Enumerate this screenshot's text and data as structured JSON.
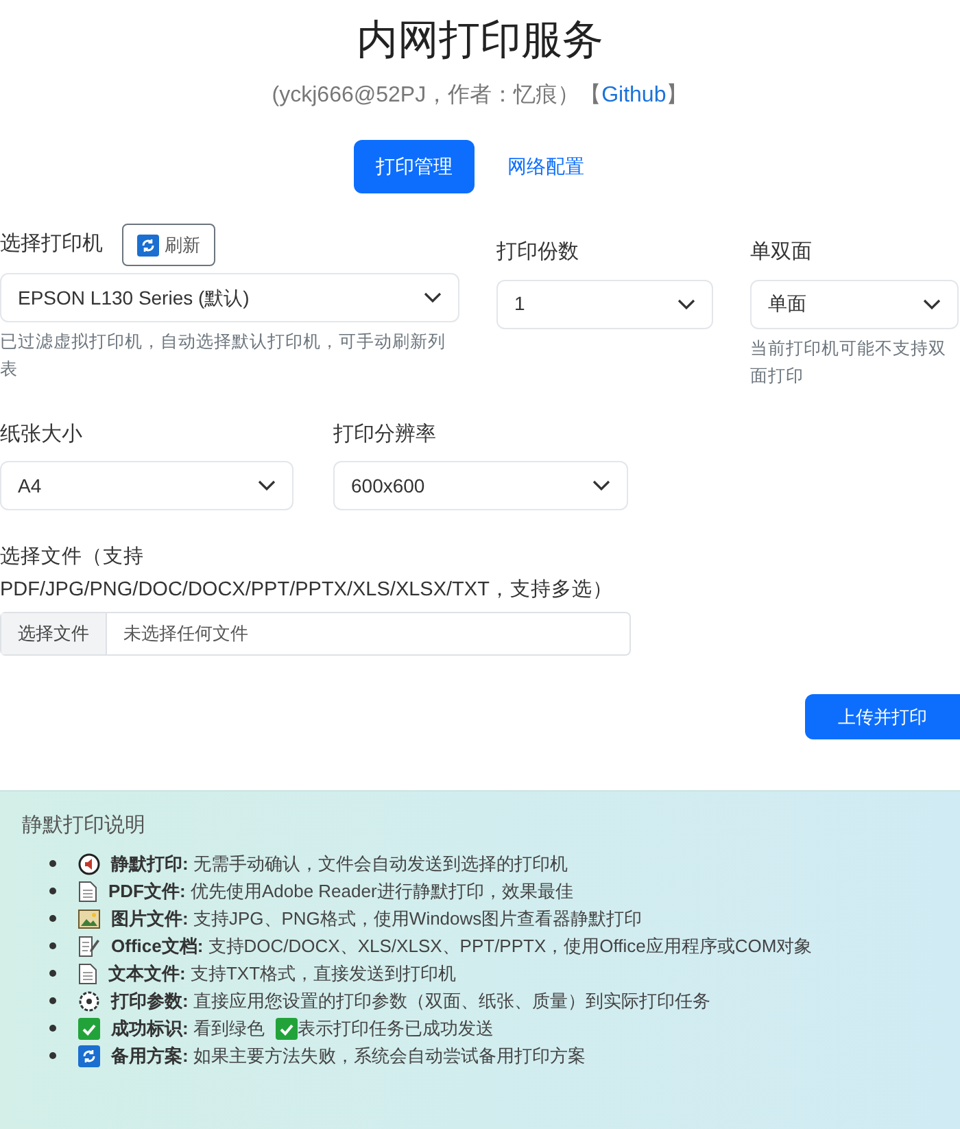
{
  "header": {
    "title": "内网打印服务",
    "subtitle": "(yckj666@52PJ，作者：忆痕）【",
    "link": "Github",
    "subtitle_end": "】"
  },
  "tabs": [
    {
      "label": "打印管理",
      "selected": true
    },
    {
      "label": "网络配置",
      "selected": false
    }
  ],
  "printer": {
    "label": "选择打印机",
    "refresh_button": "刷新",
    "value": "EPSON L130 Series (默认)",
    "hint": "已过滤虚拟打印机，自动选择默认打印机，可手动刷新列表"
  },
  "copies": {
    "label": "打印份数",
    "value": "1"
  },
  "duplex": {
    "label": "单双面",
    "value": "单面",
    "hint": "当前打印机可能不支持双面打印"
  },
  "paper": {
    "label": "纸张大小",
    "value": "A4"
  },
  "resolution": {
    "label": "打印分辨率",
    "value": "600x600"
  },
  "file": {
    "label": "选择文件（支持PDF/JPG/PNG/DOC/DOCX/PPT/PPTX/XLS/XLSX/TXT，支持多选）",
    "button": "选择文件",
    "value": "未选择任何文件"
  },
  "submit_button": "上传并打印",
  "info": {
    "title": "静默打印说明",
    "items": [
      {
        "kind": "silent",
        "term": "静默打印:",
        "text": "无需手动确认，文件会自动发送到选择的打印机"
      },
      {
        "kind": "pdf",
        "term": "PDF文件:",
        "text": "优先使用Adobe Reader进行静默打印，效果最佳"
      },
      {
        "kind": "image",
        "term": "图片文件:",
        "text": "支持JPG、PNG格式，使用Windows图片查看器静默打印"
      },
      {
        "kind": "office",
        "term": "Office文档:",
        "text": "支持DOC/DOCX、XLS/XLSX、PPT/PPTX，使用Office应用程序或COM对象"
      },
      {
        "kind": "text",
        "term": "文本文件:",
        "text": "支持TXT格式，直接发送到打印机"
      },
      {
        "kind": "settings",
        "term": "打印参数:",
        "text": "直接应用您设置的打印参数（双面、纸张、质量）到实际打印任务"
      },
      {
        "kind": "success",
        "term": "成功标识:",
        "text": "看到绿色",
        "text_after": "表示打印任务已成功发送"
      },
      {
        "kind": "fallback",
        "term": "备用方案:",
        "text": "如果主要方法失败，系统会自动尝试备用打印方案"
      }
    ]
  }
}
